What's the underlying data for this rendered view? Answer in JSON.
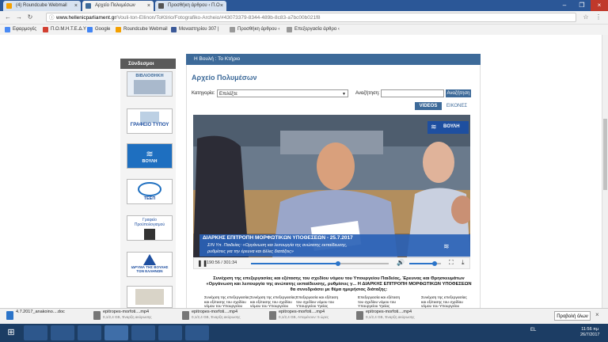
{
  "browser": {
    "tabs": [
      {
        "label": "(4) Roundcube Webmail",
        "active": false
      },
      {
        "label": "Αρχείο Πολυμέσων",
        "active": true
      },
      {
        "label": "Προσθήκη άρθρου ‹ Π.Ο",
        "active": false
      }
    ],
    "url_host": "www.hellenicparliament.gr",
    "url_path": "/Vouli-ton-Ellinon/ToKtirio/Fotografiko-Archeio/#43073379-8344-489b-8c83-a7bc00b021f8",
    "bookmarks": [
      {
        "label": "Εφαρμογές",
        "color": "#4a8af4"
      },
      {
        "label": "Π.Ο.Μ.Η.Τ.Ε.Δ.Υ",
        "color": "#d23f31"
      },
      {
        "label": "Google",
        "color": "#4285f4"
      },
      {
        "label": "Roundcube Webmail",
        "color": "#f4a000"
      },
      {
        "label": "Μοναστηρίου 307 |",
        "color": "#3b5998"
      },
      {
        "label": "Προσθήκη άρθρου ‹",
        "color": "#999999"
      },
      {
        "label": "Επεξεργασία άρθρο ‹",
        "color": "#999999"
      }
    ]
  },
  "sidebar": {
    "header": "Σύνδεσμοι",
    "banners": [
      {
        "label": "ΒΙΒΛΙΟΘΗΚΗ"
      },
      {
        "label": "ΓΡΑΦΕΙΟ ΤΥΠΟΥ"
      },
      {
        "label": "ΒΟΥΛΗ"
      },
      {
        "label": "ΤΕΕΠ"
      },
      {
        "label": "Γραφείο Προϋπολογισμού"
      },
      {
        "label": "ΙΔΡΥΜΑ ΤΗΣ ΒΟΥΛΗΣ ΤΩΝ ΕΛΛΗΝΩΝ"
      },
      {
        "label": ""
      }
    ]
  },
  "main": {
    "breadcrumb": "Η Βουλή : Το Κτήριο",
    "title": "Αρχείο Πολυμέσων",
    "category_label": "Κατηγορία:",
    "category_value": "Επιλέξτε",
    "search_label": "Αναζήτηση:",
    "search_value": "",
    "search_button": "Αναζήτηση",
    "tabs": [
      {
        "label": "VIDEOS",
        "active": true
      },
      {
        "label": "ΕΙΚΟΝΕΣ",
        "active": false
      }
    ]
  },
  "video": {
    "caption_title": "ΔΙΑΡΚΗΣ ΕΠΙΤΡΟΠΗ ΜΟΡΦΩΤΙΚΩΝ ΥΠΟΘΕΣΕΩΝ - 25.7.2017",
    "caption_line2": "Σ/Ν Υπ. Παιδείας: «Οργάνωση και λειτουργία της ανώτατης εκπαίδευσης,",
    "caption_line3": "ρυθμίσεις για την έρευνα και άλλες διατάξεις»",
    "logo_label": "ΒΟΥΛΗ",
    "time_display": "190:56 / 301:34",
    "progress": 0.63,
    "volume": 0.8
  },
  "description": "Συνέχιση της επεξεργασίας και εξέτασης του σχεδίου νόμου του Υπουργείου Παιδείας, Έρευνας και Θρησκευμάτων «Οργάνωση και λειτουργία της ανώτατης εκπαίδευσης, ρυθμίσεις γ... Η ΔΙΑΡΚΗΣ ΕΠΙΤΡΟΠΗ ΜΟΡΦΩΤΙΚΩΝ ΥΠΟΘΕΣΕΩΝ θα συνεδριάσει με θέμα ημερήσιας διάταξης:",
  "thumbnails": [
    {
      "text": "Συνέχιση της επεξεργασίας και εξέτασης του σχεδίου νόμου του Υπουργείου"
    },
    {
      "text": "Συνέχιση της επεξεργασίας και εξέτασης του σχεδίου νόμου του Υπουργείου"
    },
    {
      "text": "Επεξεργασία και εξέταση του σχεδίου νόμου του Υπουργείου Υγείας"
    },
    {
      "text": "Επεξεργασία και εξέταση του σχεδίου νόμου του Υπουργείου Υγείας"
    },
    {
      "text": "Συνέχιση της επεξεργασίας και εξέτασης του σχεδίου νόμου του Υπουργείου"
    }
  ],
  "downloads": {
    "items": [
      {
        "name": "4.7.2017_anakoino....doc",
        "status": ""
      },
      {
        "name": "epitropes-morfoti....mp4",
        "status": "0,1/2,4 GB, Έναρξη ακύρωσης"
      },
      {
        "name": "epitropes-morfoti....mp4",
        "status": "0,1/2,4 GB, Έναρξη ακύρωσης"
      },
      {
        "name": "epitropes-morfoti....mp4",
        "status": "0,1/2,4 GB, Απομένουν: 5 ώρες"
      },
      {
        "name": "epitropes-morfoti....mp4",
        "status": "0,1/2,4 GB, Έναρξη ακύρωσης"
      }
    ],
    "show_all": "Προβολή όλων"
  },
  "taskbar": {
    "lang": "EL",
    "time": "11:56 πμ",
    "date": "26/7/2017"
  }
}
